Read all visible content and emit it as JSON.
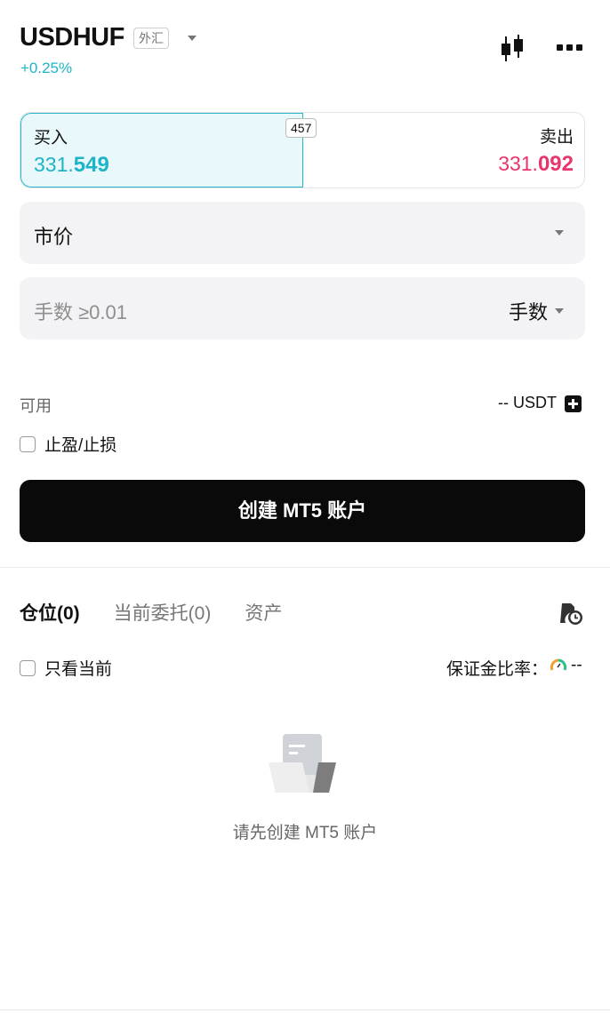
{
  "header": {
    "symbol": "USDHUF",
    "category_tag": "外汇",
    "change": "+0.25%",
    "icons": [
      "candlestick-icon",
      "more-icon",
      "chevron-down-icon"
    ]
  },
  "quote": {
    "buy_label": "买入",
    "buy_price_prefix": "331.",
    "buy_price_emph": "549",
    "sell_label": "卖出",
    "sell_price_prefix": "331.",
    "sell_price_emph": "092",
    "spread": "457",
    "colors": {
      "buy": "#1eb4c8",
      "sell": "#e8356c"
    }
  },
  "order": {
    "type_value": "市价",
    "lots_placeholder": "手数 ≥0.01",
    "lots_unit": "手数"
  },
  "account": {
    "available_label": "可用",
    "available_value": "-- USDT",
    "tp_sl_label": "止盈/止损",
    "create_button": "创建 MT5 账户"
  },
  "positions": {
    "tabs": [
      {
        "label": "仓位(0)",
        "active": true
      },
      {
        "label": "当前委托(0)",
        "active": false
      },
      {
        "label": "资产",
        "active": false
      }
    ],
    "only_current_label": "只看当前",
    "margin_ratio_label": "保证金比率：",
    "margin_ratio_value": "--",
    "empty_text": "请先创建 MT5 账户"
  }
}
